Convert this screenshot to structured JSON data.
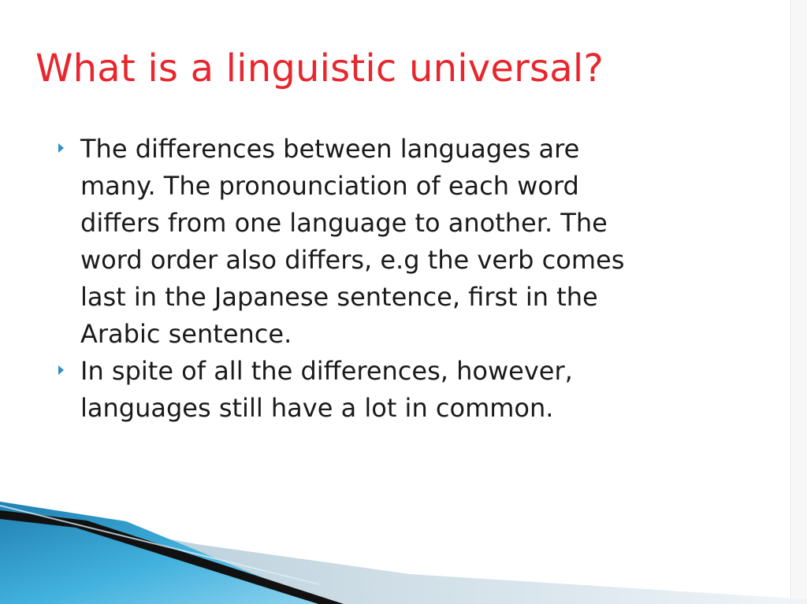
{
  "slide": {
    "title": "What is a linguistic universal?",
    "bullets": [
      {
        "text": "The differences between  languages are\nmany. The pronounciation of each word\ndiffers from one language to another. The\nword order also differs, e.g   the verb comes\nlast in the Japanese sentence, first in the\nArabic sentence."
      },
      {
        "text": "In spite of all the differences, however,\nlanguages still have a lot in common."
      }
    ]
  },
  "theme": {
    "title_color": "#e8262d",
    "bullet_color": "#2b91c8",
    "text_color": "#1a1a1a",
    "accent_blue": "#2f97c9",
    "accent_dark": "#111111"
  },
  "icons": {
    "bullet": "triangle-right-icon"
  }
}
